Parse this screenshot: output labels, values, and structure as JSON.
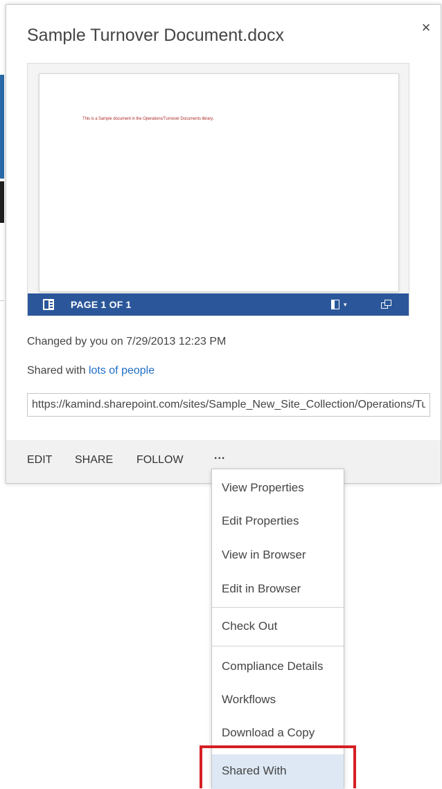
{
  "callout": {
    "title": "Sample Turnover Document.docx",
    "close_glyph": "×",
    "preview": {
      "document_text": "This is a Sample document in the Operations/Turnover Documents library.",
      "page_indicator": "PAGE 1 OF 1",
      "dropdown_glyph": "▾"
    },
    "changed_text": "Changed by you on 7/29/2013 12:23 PM",
    "shared_prefix": "Shared with ",
    "shared_link": "lots of people",
    "url_value": "https://kamind.sharepoint.com/sites/Sample_New_Site_Collection/Operations/Turnover Documents/Sample Turnover Document.docx",
    "actions": {
      "edit": "EDIT",
      "share": "SHARE",
      "follow": "FOLLOW",
      "more": "..."
    }
  },
  "menu": {
    "items": [
      "View Properties",
      "Edit Properties",
      "View in Browser",
      "Edit in Browser",
      "Check Out",
      "Compliance Details",
      "Workflows",
      "Download a Copy",
      "Shared With"
    ],
    "selected": "Shared With"
  },
  "colors": {
    "viewer_bar": "#2b579a",
    "link": "#1f6ec7",
    "highlight_border": "#d51f24",
    "selected_item": "#dde8f4"
  },
  "icons": [
    "close-icon",
    "word-icon",
    "reading-pane-icon",
    "dropdown-arrow-icon",
    "popout-icon"
  ]
}
